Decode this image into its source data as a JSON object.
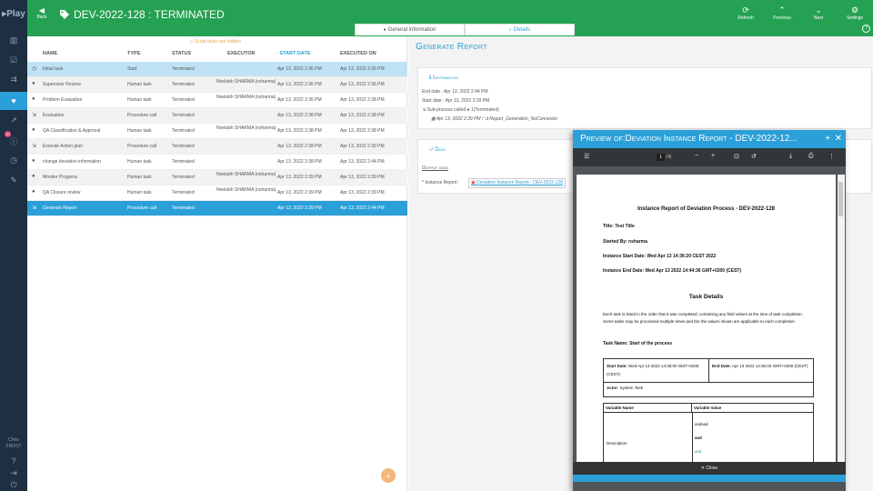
{
  "app": {
    "logo": "Play"
  },
  "sidebar": {
    "icons": [
      "dashboard-icon",
      "checklist-icon",
      "flow-icon",
      "heart-pulse-icon",
      "chart-icon",
      "info-icon",
      "clock-icon",
      "wrench-icon"
    ],
    "active_index": 3,
    "badge": "10",
    "user_first": "Chris",
    "user_last": "FROST"
  },
  "header": {
    "back_label": "Back",
    "title": "DEV-2022-128 : TERMINATED",
    "refresh": "Refresh",
    "previous": "Previous",
    "next": "Next",
    "settings": "Settings"
  },
  "tabs": [
    {
      "label": "General information"
    },
    {
      "label": "Details"
    }
  ],
  "table": {
    "hidden_note": "Script tasks are hidden",
    "columns": [
      "Name",
      "Type",
      "Status",
      "Executor",
      "Start date",
      "Executed on"
    ],
    "rows": [
      {
        "name": "Initial task",
        "type": "Start",
        "status": "Terminated",
        "executor": "",
        "start": "Apr 13, 2022 2:36 PM",
        "executed": "Apr 13, 2022 2:36 PM",
        "icon": "clock-icon"
      },
      {
        "name": "Supervisor Review",
        "type": "Human task",
        "status": "Terminated",
        "executor": "Neelabh SHARMA (nsharma)",
        "start": "Apr 13, 2022 2:36 PM",
        "executed": "Apr 13, 2022 2:36 PM",
        "icon": "person-icon"
      },
      {
        "name": "Problem Evaluation",
        "type": "Human task",
        "status": "Terminated",
        "executor": "Neelabh SHARMA (nsharma)",
        "start": "Apr 13, 2022 2:36 PM",
        "executed": "Apr 13, 2022 2:38 PM",
        "icon": "person-icon"
      },
      {
        "name": "Evaluation",
        "type": "Procedure call",
        "status": "Terminated",
        "executor": "",
        "start": "Apr 13, 2022 2:38 PM",
        "executed": "Apr 13, 2022 2:38 PM",
        "icon": "subprocess-icon"
      },
      {
        "name": "QA Classification & Approval",
        "type": "Human task",
        "status": "Terminated",
        "executor": "Neelabh SHARMA (nsharma)",
        "start": "Apr 13, 2022 2:38 PM",
        "executed": "Apr 13, 2022 2:38 PM",
        "icon": "person-icon"
      },
      {
        "name": "Execute Action plan",
        "type": "Procedure call",
        "status": "Terminated",
        "executor": "",
        "start": "Apr 13, 2022 2:38 PM",
        "executed": "Apr 13, 2022 2:39 PM",
        "icon": "subprocess-icon"
      },
      {
        "name": "change deviation information",
        "type": "Human task",
        "status": "Terminated",
        "executor": "",
        "start": "Apr 13, 2022 2:38 PM",
        "executed": "Apr 13, 2022 2:44 PM",
        "icon": "person-icon"
      },
      {
        "name": "Monitor Progress",
        "type": "Human task",
        "status": "Terminated",
        "executor": "Neelabh SHARMA (nsharma)",
        "start": "Apr 13, 2022 2:39 PM",
        "executed": "Apr 13, 2022 2:39 PM",
        "icon": "person-icon"
      },
      {
        "name": "QA Closure review",
        "type": "Human task",
        "status": "Terminated",
        "executor": "Neelabh SHARMA (nsharma)",
        "start": "Apr 13, 2022 2:39 PM",
        "executed": "Apr 13, 2022 2:39 PM",
        "icon": "person-icon"
      },
      {
        "name": "Generate Report",
        "type": "Procedure call",
        "status": "Terminated",
        "executor": "",
        "start": "Apr 13, 2022 2:39 PM",
        "executed": "Apr 13, 2022 2:44 PM",
        "icon": "subprocess-icon"
      }
    ]
  },
  "details": {
    "heading": "Generate Report",
    "info_title": "Information",
    "end_date": "End date : Apr 13, 2022 2:44 PM",
    "start_date": "Start date : Apr 13, 2022 2:39 PM",
    "subprocess": "Sub-process called",
    "subprocess_count": "1(Terminated)",
    "subprocess_date": "Apr 13, 2022 2:39 PM /",
    "subprocess_name": "Report_Generation_NoConnector",
    "data_title": "Data",
    "output_label": "Output data",
    "instance_report_label": "* Instance Report :",
    "instance_report_link": "Deviation Instance Report - DEV-2022-128"
  },
  "preview": {
    "title": "Preview of:Deviation Instance Report - DEV-2022-12...",
    "page_current": "1",
    "page_total": "/ 6",
    "close_label": "Close",
    "doc": {
      "title": "Instance Report of Deviation Process - DEV-2022-128",
      "title_line": "Title: Test Title",
      "started_by": "Started By: nsharma",
      "start_date": "Instance Start Date: Wed Apr 13 14:36:20 CEST 2022",
      "end_date": "Instance End Date: Wed Apr 13 2022 14:44:36 GMT+0200 (CEST)",
      "task_details": "Task Details",
      "para": "Each task is listed in the order that it was completed, containing any field values at the time of task completion. Some tasks may be processed multiple times and the the values shown are applicable to each completion",
      "task_name": "Task Name: Start of the process",
      "start_label": "Start Date:",
      "start_val": "Wed Apr 13 2022 14:36:00 GMT+0200 (CEST)",
      "end_label": "End Date:",
      "end_val": "Apr 13 2022 14:36:00 GMT+0200 (CEST)",
      "actor_label": "Actor:",
      "actor_val": "System Task",
      "var_name_h": "Variable Name",
      "var_val_h": "Variable Value",
      "var_name": "Description",
      "val1": "asdsad",
      "val2": "asd",
      "val3": "asd"
    }
  },
  "colors": {
    "header": "#24a152",
    "accent": "#2a9fd8",
    "rail": "#1d2f40"
  }
}
